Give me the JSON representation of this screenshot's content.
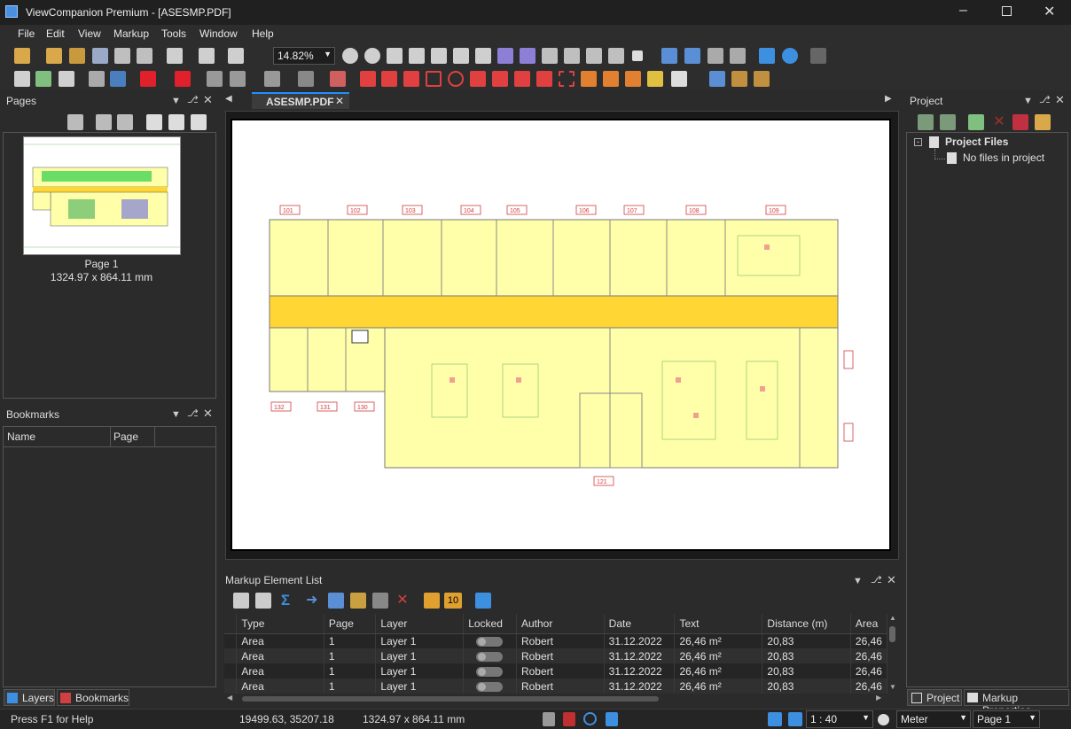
{
  "window": {
    "title": "ViewCompanion Premium - [ASESMP.PDF]"
  },
  "menu": [
    "File",
    "Edit",
    "View",
    "Markup",
    "Tools",
    "Window",
    "Help"
  ],
  "toolbar": {
    "zoom": "14.82%"
  },
  "pages_panel": {
    "title": "Pages",
    "page_label": "Page 1",
    "page_size": "1324.97 x 864.11 mm"
  },
  "bookmarks_panel": {
    "title": "Bookmarks",
    "columns": [
      "Name",
      "Page"
    ]
  },
  "left_tabs": [
    "Layers",
    "Bookmarks"
  ],
  "doc_tab": {
    "label": "ASESMP.PDF"
  },
  "plan": {
    "rooms_top": [
      "101",
      "102",
      "103",
      "104",
      "105",
      "106",
      "107",
      "108",
      "109"
    ],
    "rooms_bottom": [
      "132",
      "131",
      "130"
    ],
    "room_bottom_right": "121"
  },
  "project_panel": {
    "title": "Project",
    "root": "Project Files",
    "child": "No files in project"
  },
  "right_tabs": [
    "Project",
    "Markup Properties"
  ],
  "markup_list": {
    "title": "Markup Element List",
    "badge": "10",
    "columns": [
      "Type",
      "Page",
      "Layer",
      "Locked",
      "Author",
      "Date",
      "Text",
      "Distance (m)",
      "Area"
    ],
    "rows": [
      {
        "type": "Area",
        "page": "1",
        "layer": "Layer 1",
        "author": "Robert",
        "date": "31.12.2022",
        "text": "26,46 m²",
        "distance": "20,83",
        "area": "26,46"
      },
      {
        "type": "Area",
        "page": "1",
        "layer": "Layer 1",
        "author": "Robert",
        "date": "31.12.2022",
        "text": "26,46 m²",
        "distance": "20,83",
        "area": "26,46"
      },
      {
        "type": "Area",
        "page": "1",
        "layer": "Layer 1",
        "author": "Robert",
        "date": "31.12.2022",
        "text": "26,46 m²",
        "distance": "20,83",
        "area": "26,46"
      },
      {
        "type": "Area",
        "page": "1",
        "layer": "Layer 1",
        "author": "Robert",
        "date": "31.12.2022",
        "text": "26,46 m²",
        "distance": "20,83",
        "area": "26,46"
      }
    ]
  },
  "status": {
    "help": "Press F1 for Help",
    "coords": "19499.63, 35207.18",
    "size": "1324.97 x 864.11 mm",
    "scale": "1 : 40",
    "unit": "Meter",
    "page": "Page 1"
  },
  "colors": {
    "accent": "#1e90ff",
    "room_fill": "#ffffaa",
    "corridor": "#ffd633",
    "label_red": "#d04040"
  }
}
